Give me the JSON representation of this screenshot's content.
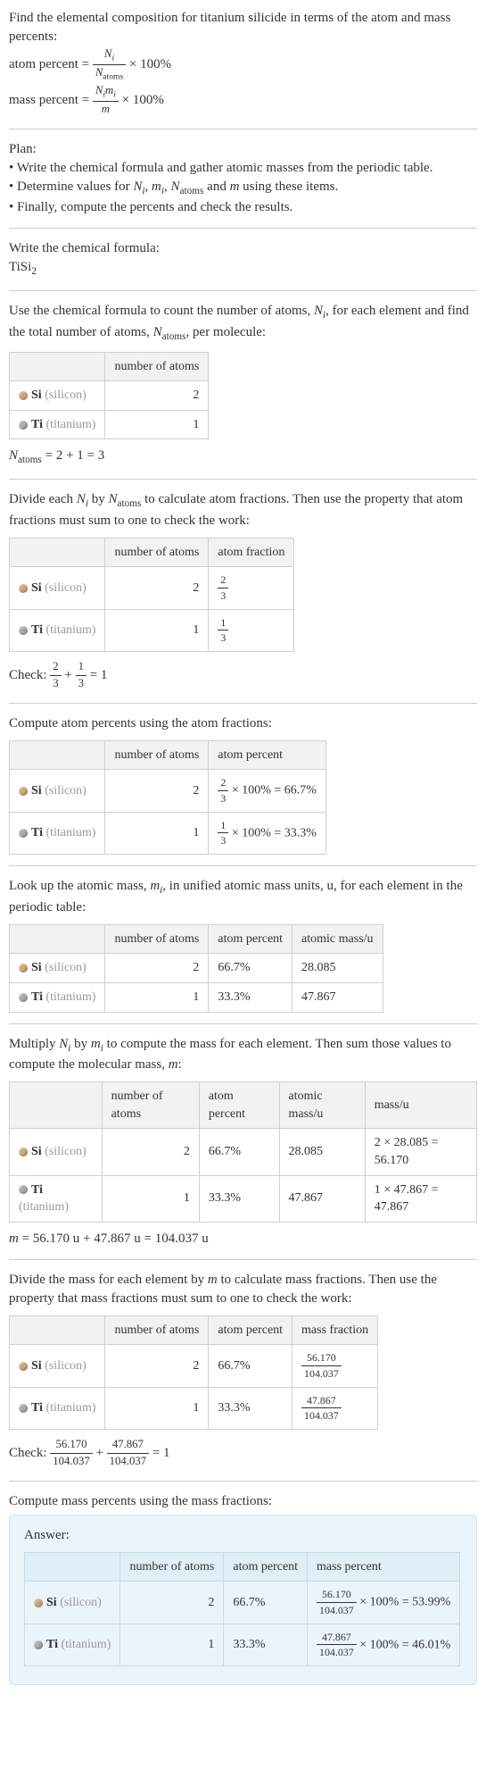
{
  "intro": {
    "line1": "Find the elemental composition for titanium silicide in terms of the atom and mass percents:",
    "atom_percent_label": "atom percent = ",
    "atom_percent_num": "N_i",
    "atom_percent_den": "N_atoms",
    "times100": " × 100%",
    "mass_percent_label": "mass percent = ",
    "mass_percent_num": "N_i m_i",
    "mass_percent_den": "m"
  },
  "plan": {
    "heading": "Plan:",
    "item1": "• Write the chemical formula and gather atomic masses from the periodic table.",
    "item2_a": "• Determine values for ",
    "item2_b": " using these items.",
    "item3": "• Finally, compute the percents and check the results."
  },
  "formula": {
    "heading": "Write the chemical formula:",
    "value": "TiSi",
    "sub": "2"
  },
  "count": {
    "text_a": "Use the chemical formula to count the number of atoms, ",
    "text_b": ", for each element and find the total number of atoms, ",
    "text_c": ", per molecule:",
    "col1": "number of atoms",
    "si_name": "Si",
    "si_paren": " (silicon)",
    "si_atoms": "2",
    "ti_name": "Ti",
    "ti_paren": " (titanium)",
    "ti_atoms": "1",
    "sum": " = 2 + 1 = 3"
  },
  "atomfrac": {
    "text_a": "Divide each ",
    "text_b": " by ",
    "text_c": " to calculate atom fractions. Then use the property that atom fractions must sum to one to check the work:",
    "col1": "number of atoms",
    "col2": "atom fraction",
    "si_frac_n": "2",
    "si_frac_d": "3",
    "ti_frac_n": "1",
    "ti_frac_d": "3",
    "check_label": "Check: ",
    "check_eq": " = 1"
  },
  "atompct": {
    "heading": "Compute atom percents using the atom fractions:",
    "col1": "number of atoms",
    "col2": "atom percent",
    "si_pct": " × 100% = 66.7%",
    "ti_pct": " × 100% = 33.3%"
  },
  "mass": {
    "text_a": "Look up the atomic mass, ",
    "text_b": ", in unified atomic mass units, u, for each element in the periodic table:",
    "col1": "number of atoms",
    "col2": "atom percent",
    "col3": "atomic mass/u",
    "si_pct": "66.7%",
    "ti_pct": "33.3%",
    "si_mass": "28.085",
    "ti_mass": "47.867"
  },
  "molmass": {
    "text_a": "Multiply ",
    "text_b": " by ",
    "text_c": " to compute the mass for each element. Then sum those values to compute the molecular mass, ",
    "text_d": ":",
    "col1": "number of atoms",
    "col2": "atom percent",
    "col3": "atomic mass/u",
    "col4": "mass/u",
    "si_calc": "2 × 28.085 = 56.170",
    "ti_calc": "1 × 47.867 = 47.867",
    "sum": " = 56.170 u + 47.867 u = 104.037 u"
  },
  "massfrac": {
    "text_a": "Divide the mass for each element by ",
    "text_b": " to calculate mass fractions. Then use the property that mass fractions must sum to one to check the work:",
    "col1": "number of atoms",
    "col2": "atom percent",
    "col3": "mass fraction",
    "si_num": "56.170",
    "si_den": "104.037",
    "ti_num": "47.867",
    "ti_den": "104.037",
    "check_label": "Check: ",
    "check_eq": " = 1"
  },
  "masspct": {
    "heading": "Compute mass percents using the mass fractions:",
    "answer_label": "Answer:",
    "col1": "number of atoms",
    "col2": "atom percent",
    "col3": "mass percent",
    "si_atoms": "2",
    "si_pct": "66.7%",
    "si_calc": " × 100% = 53.99%",
    "ti_atoms": "1",
    "ti_pct": "33.3%",
    "ti_calc": " × 100% = 46.01%"
  },
  "chart_data": {
    "type": "table",
    "compound": "TiSi2",
    "elements": [
      {
        "symbol": "Si",
        "name": "silicon",
        "atoms": 2,
        "atom_fraction": "2/3",
        "atom_percent": 66.7,
        "atomic_mass_u": 28.085,
        "mass_u": 56.17,
        "mass_fraction": 0.5399,
        "mass_percent": 53.99
      },
      {
        "symbol": "Ti",
        "name": "titanium",
        "atoms": 1,
        "atom_fraction": "1/3",
        "atom_percent": 33.3,
        "atomic_mass_u": 47.867,
        "mass_u": 47.867,
        "mass_fraction": 0.4601,
        "mass_percent": 46.01
      }
    ],
    "N_atoms": 3,
    "molecular_mass_u": 104.037
  }
}
